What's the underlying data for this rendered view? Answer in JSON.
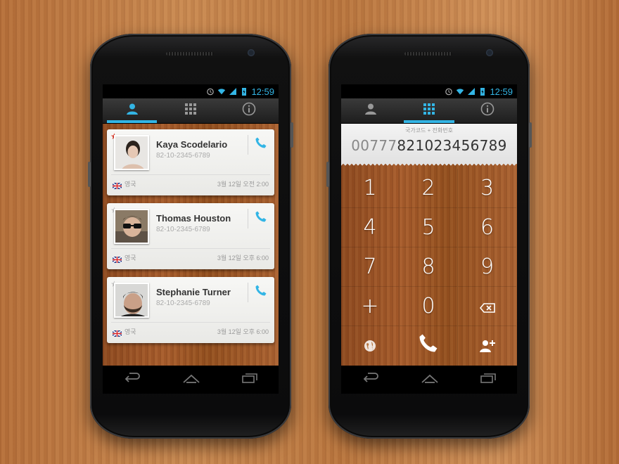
{
  "status": {
    "time": "12:59"
  },
  "left_phone": {
    "tabs": [
      {
        "name": "contacts-icon",
        "active": true
      },
      {
        "name": "dialpad-icon",
        "active": false
      },
      {
        "name": "info-icon",
        "active": false
      }
    ],
    "contacts": [
      {
        "name": "Kaya Scodelario",
        "phone": "82-10-2345-6789",
        "country": "영국",
        "time": "3월 12일 오전 2:00",
        "starred": true
      },
      {
        "name": "Thomas Houston",
        "phone": "82-10-2345-6789",
        "country": "영국",
        "time": "3월 12일 오후 6:00",
        "starred": false
      },
      {
        "name": "Stephanie Turner",
        "phone": "82-10-2345-6789",
        "country": "영국",
        "time": "3월 12일 오후 6:00",
        "starred": false
      }
    ]
  },
  "right_phone": {
    "number_label": "국가코드 + 전화번호",
    "number_prefix": "00777",
    "number_main": "821023456789",
    "keys": [
      "1",
      "2",
      "3",
      "4",
      "5",
      "6",
      "7",
      "8",
      "9",
      "+",
      "0"
    ]
  },
  "colors": {
    "accent": "#33b5e5",
    "star_active": "#e03a2a",
    "star_inactive": "#c8c8c8"
  }
}
